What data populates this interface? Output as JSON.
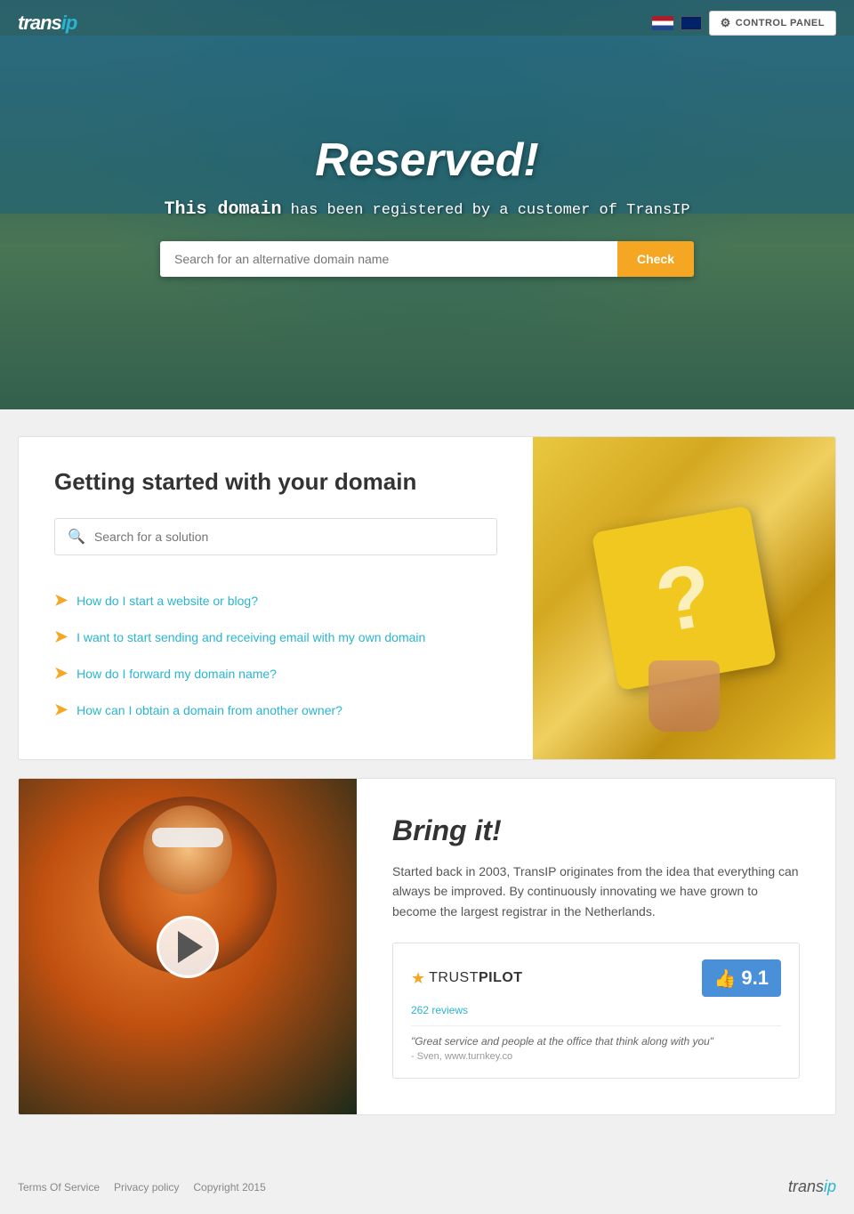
{
  "header": {
    "logo_trans": "trans",
    "logo_ip": "ip",
    "control_panel_label": "CONTROL PANEL"
  },
  "hero": {
    "title": "Reserved!",
    "subtitle_prefix": "This domain",
    "subtitle_rest": "has been registered by a customer of TransIP",
    "search_placeholder": "Search for an alternative domain name",
    "search_button": "Check"
  },
  "getting_started": {
    "title": "Getting started with your domain",
    "search_placeholder": "Search for a solution",
    "faq_items": [
      {
        "text": "How do I start a website or blog?"
      },
      {
        "text": "I want to start sending and receiving email with my own domain"
      },
      {
        "text": "How do I forward my domain name?"
      },
      {
        "text": "How can I obtain a domain from another owner?"
      }
    ]
  },
  "bring_it": {
    "title": "Bring it!",
    "description": "Started back in 2003, TransIP originates from the idea that everything can always be improved. By continuously innovating we have grown to become the largest registrar in the Netherlands.",
    "trustpilot": {
      "label_trust": "TRUST",
      "label_pilot": "PILOT",
      "reviews_count": "262 reviews",
      "score": "9.1",
      "quote": "\"Great service and people at the office that think along with you\"",
      "author": "- Sven, www.turnkey.co"
    }
  },
  "footer": {
    "terms_label": "Terms Of Service",
    "privacy_label": "Privacy policy",
    "copyright_label": "Copyright 2015",
    "logo_trans": "trans",
    "logo_ip": "ip"
  },
  "colors": {
    "accent_orange": "#f5a623",
    "accent_teal": "#29b5d1",
    "accent_blue": "#4a90d9"
  }
}
